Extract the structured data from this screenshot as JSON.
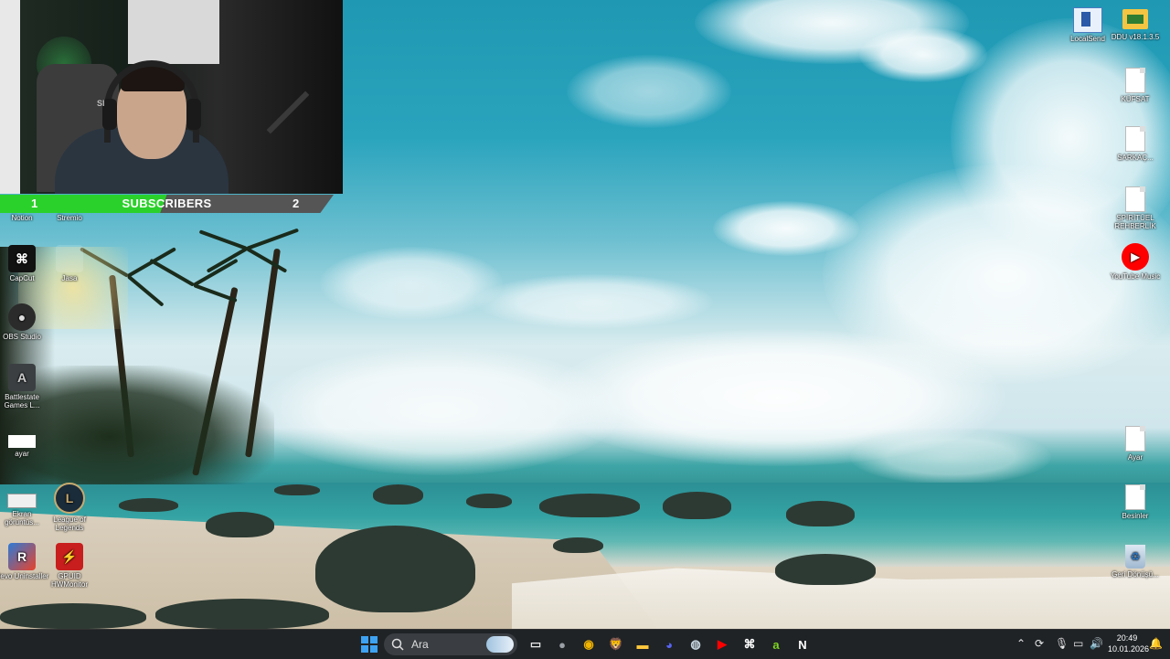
{
  "overlay": {
    "subscribers_label": "SUBSCRIBERS",
    "current": "1",
    "goal": "2",
    "progress": 0.5,
    "webcam_shirt_text": "SI"
  },
  "left_icons": [
    {
      "label": "Notion"
    },
    {
      "label": "Stremio"
    },
    {
      "label": "CapCut",
      "glyph": "⌘"
    },
    {
      "label": "Jasa",
      "glyph": ""
    },
    {
      "label": "OBS Studio",
      "glyph": "●"
    },
    {
      "label": "Battlestate Games L...",
      "glyph": "A"
    },
    {
      "label": "ayar"
    },
    {
      "label": "Ekran görüntüs...",
      "glyph": ""
    },
    {
      "label": "League of Legends",
      "glyph": "L"
    },
    {
      "label": "Revo Uninstaller",
      "glyph": "R"
    },
    {
      "label": "GPUID HWMonitor",
      "glyph": "⚡"
    }
  ],
  "right_icons": [
    {
      "label": "LocalSend"
    },
    {
      "label": "DDU v18.1.3.5"
    },
    {
      "label": "KÜFSAT"
    },
    {
      "label": "SARKAÇ..."
    },
    {
      "label": "SPİRİTÜEL REHBERLİK"
    },
    {
      "label": "YouTube Music"
    },
    {
      "label": "Ayar"
    },
    {
      "label": "Besinler"
    },
    {
      "label": "Geri Dönüşü..."
    }
  ],
  "taskbar": {
    "search_placeholder": "Ara",
    "apps": [
      {
        "name": "task-view",
        "glyph": "▭",
        "color": "#e8e8e8"
      },
      {
        "name": "obs",
        "glyph": "●",
        "color": "#9aa0a6"
      },
      {
        "name": "chrome",
        "glyph": "◉",
        "color": "#f1b400"
      },
      {
        "name": "brave",
        "glyph": "🦁",
        "color": "#fb542b"
      },
      {
        "name": "file-explorer",
        "glyph": "▬",
        "color": "#ffc83d"
      },
      {
        "name": "discord",
        "glyph": "◕",
        "color": "#5865f2"
      },
      {
        "name": "steam",
        "glyph": "◍",
        "color": "#c7d5e0"
      },
      {
        "name": "youtube-music",
        "glyph": "▶",
        "color": "#ff0000"
      },
      {
        "name": "capcut",
        "glyph": "⌘",
        "color": "#ffffff"
      },
      {
        "name": "green-app",
        "glyph": "a",
        "color": "#7ed321"
      },
      {
        "name": "notion",
        "glyph": "N",
        "color": "#ffffff"
      }
    ],
    "time": "20:49",
    "date": "10.01.2026"
  }
}
